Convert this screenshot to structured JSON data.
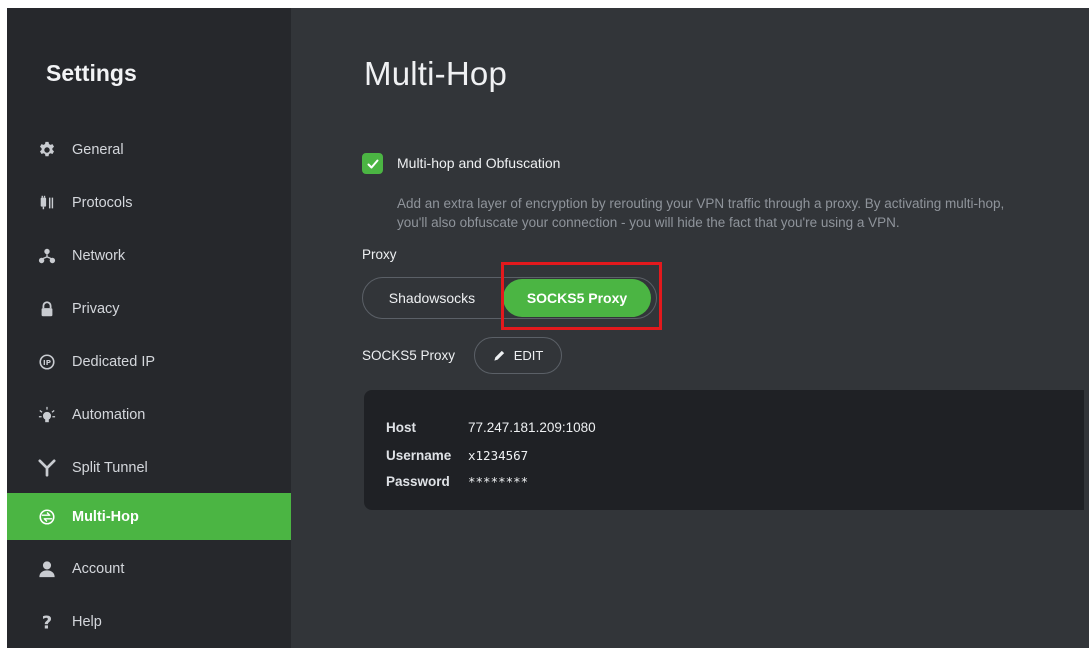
{
  "sidebar": {
    "title": "Settings",
    "items": [
      {
        "label": "General",
        "icon": "gear-icon"
      },
      {
        "label": "Protocols",
        "icon": "protocols-icon"
      },
      {
        "label": "Network",
        "icon": "network-icon"
      },
      {
        "label": "Privacy",
        "icon": "lock-icon"
      },
      {
        "label": "Dedicated IP",
        "icon": "dedicated-ip-icon"
      },
      {
        "label": "Automation",
        "icon": "automation-icon"
      },
      {
        "label": "Split Tunnel",
        "icon": "split-tunnel-icon"
      },
      {
        "label": "Multi-Hop",
        "icon": "multihop-icon",
        "active": true
      },
      {
        "label": "Account",
        "icon": "user-icon"
      },
      {
        "label": "Help",
        "icon": "help-icon"
      }
    ]
  },
  "main": {
    "title": "Multi-Hop",
    "multihop": {
      "checked": true,
      "label": "Multi-hop and Obfuscation",
      "description_line1": "Add an extra layer of encryption by rerouting your VPN traffic through a proxy. By activating multi-hop,",
      "description_line2": "you'll also obfuscate your connection - you will hide the fact that you're using a VPN."
    },
    "proxy": {
      "label": "Proxy",
      "options": [
        "Shadowsocks",
        "SOCKS5 Proxy"
      ],
      "selected": "SOCKS5 Proxy"
    },
    "socks": {
      "label": "SOCKS5 Proxy",
      "edit_label": "EDIT"
    },
    "details": {
      "host_label": "Host",
      "host_value": "77.247.181.209:1080",
      "username_label": "Username",
      "username_value": "x1234567",
      "password_label": "Password",
      "password_value": "********"
    }
  },
  "colors": {
    "accent": "#4bb543",
    "sidebar_bg": "#26282c",
    "main_bg": "#323539",
    "panel_bg": "#1f2125",
    "highlight": "#e3191d"
  }
}
